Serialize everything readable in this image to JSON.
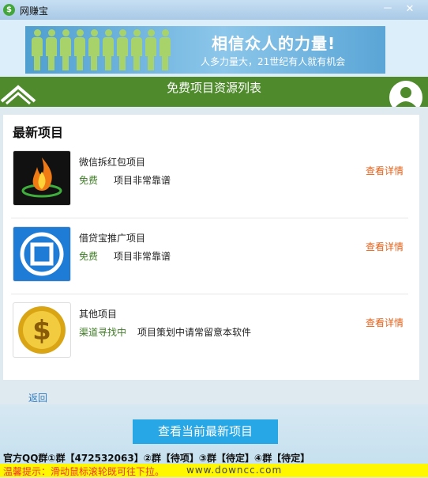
{
  "window": {
    "title": "网赚宝",
    "min_glyph": "－",
    "close_glyph": "✕"
  },
  "banner": {
    "slogan": "相信众人的力量!",
    "subslogan": "人多力量大，21世纪有人就有机会"
  },
  "header": {
    "title": "免费项目资源列表"
  },
  "section": {
    "title": "最新项目"
  },
  "items": [
    {
      "name": "微信拆红包项目",
      "tag": "免费",
      "desc": "项目非常靠谱",
      "link": "查看详情",
      "icon": "flame-icon"
    },
    {
      "name": "借贷宝推广项目",
      "tag": "免费",
      "desc": "项目非常靠谱",
      "link": "查看详情",
      "icon": "jiedaibao-logo-icon"
    },
    {
      "name": "其他项目",
      "tag": "渠道寻找中",
      "desc": "项目策划中请常留意本软件",
      "link": "查看详情",
      "icon": "dollar-coin-icon"
    }
  ],
  "back": {
    "label": "返回"
  },
  "cta": {
    "label": "查看当前最新项目"
  },
  "qq": {
    "text": "官方QQ群①群【472532063】②群【待项】③群【待定】④群【待定】"
  },
  "tip": {
    "text": "温馨提示：滑动鼠标滚轮既可往下拉。",
    "watermark": "www.downcc.com"
  },
  "colors": {
    "green": "#4f8b2c",
    "link": "#e2621b",
    "cta": "#28a7e6",
    "tip_bg": "#fff700"
  }
}
